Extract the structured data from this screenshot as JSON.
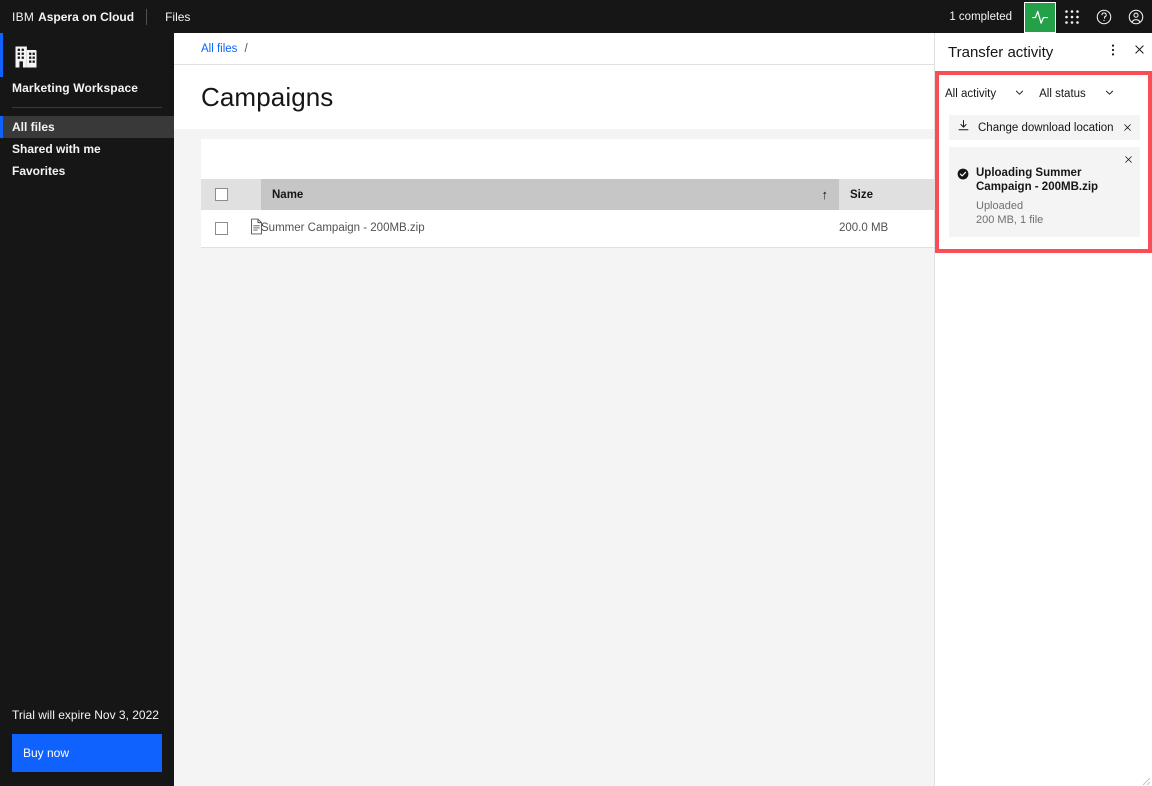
{
  "topbar": {
    "brand_prefix": "IBM",
    "brand_name": "Aspera on Cloud",
    "nav": [
      {
        "label": "Files"
      }
    ],
    "completed_status": "1 completed",
    "icons": {
      "activity": "activity-pulse-icon",
      "switcher": "app-switcher-icon",
      "help": "help-circle-icon",
      "account": "user-avatar-icon"
    }
  },
  "sidebar": {
    "workspace_icon": "enterprise-building-icon",
    "workspace_name": "Marketing Workspace",
    "items": [
      {
        "label": "All files",
        "active": true
      },
      {
        "label": "Shared with me",
        "active": false
      },
      {
        "label": "Favorites",
        "active": false
      }
    ],
    "trial_text": "Trial will expire Nov 3, 2022",
    "buy_label": "Buy now",
    "accent_color": "#0f62fe",
    "buy_color": "#0f62fe",
    "background": "#161616",
    "active_background": "#393939"
  },
  "main": {
    "breadcrumb": [
      {
        "label": "All files",
        "link": true
      }
    ],
    "breadcrumb_separator": "/",
    "page_title": "Campaigns",
    "table": {
      "columns": [
        {
          "key": "check",
          "label": ""
        },
        {
          "key": "icon",
          "label": ""
        },
        {
          "key": "name",
          "label": "Name",
          "sorted": true,
          "sort_arrow": "↑"
        },
        {
          "key": "size",
          "label": "Size"
        }
      ],
      "rows": [
        {
          "selected": false,
          "icon": "document-file-icon",
          "name": "Summer Campaign - 200MB.zip",
          "size": "200.0 MB"
        }
      ]
    }
  },
  "panel": {
    "title": "Transfer activity",
    "overflow_icon": "overflow-menu-vertical-icon",
    "close_icon": "close-icon",
    "filters": [
      {
        "label": "All activity",
        "icon": "chevron-down-icon"
      },
      {
        "label": "All status",
        "icon": "chevron-down-icon"
      }
    ],
    "change_download": {
      "icon": "download-icon",
      "label": "Change download location",
      "close_icon": "close-icon"
    },
    "transfers": [
      {
        "status_icon": "checkmark-filled-icon",
        "name": "Uploading Summer Campaign - 200MB.zip",
        "status": "Uploaded",
        "details": "200 MB, 1 file",
        "close_icon": "close-icon"
      }
    ],
    "highlight_color": "#fa4d56"
  }
}
